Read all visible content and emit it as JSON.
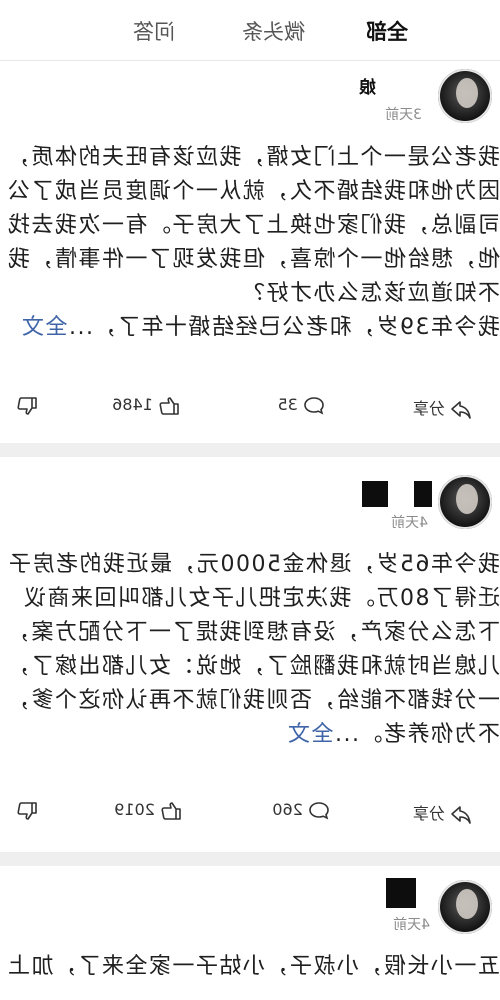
{
  "tabs": [
    {
      "label": "全部",
      "active": true
    },
    {
      "label": "微头条",
      "active": false
    },
    {
      "label": "问答",
      "active": false
    }
  ],
  "posts": [
    {
      "name_fragment": "娘",
      "time": "3天前",
      "lines": [
        "我老公是一个上门女婿，我应该有旺夫的体质，",
        "因为他和我结婚不久，就从一个调度员当成了公",
        "司副总，我们家也换上了大房子。有一次我去找",
        "他，想给他一个惊喜，但我发现了一件事情，我",
        "不知道应该怎么办才好？"
      ],
      "preview": "我今年39岁，和老公已经结婚十年了，...",
      "full_label": "全文",
      "share_label": "分享",
      "comments": "35",
      "likes": "1486"
    },
    {
      "name_fragment": "",
      "time": "4天前",
      "lines": [
        "我今年65岁，退休金5000元，最近我的老房子",
        "迁得了80万。我决定把儿子女儿都叫回来商议",
        "下怎么分家产，没有想到我提了一下分配方案，",
        "儿媳当时就和我翻脸了，她说：女儿都出嫁了，",
        "一分钱都不能给，否则我们就不再认你这个爹，"
      ],
      "preview": "不为你养老。...",
      "full_label": "全文",
      "share_label": "分享",
      "comments": "260",
      "likes": "2019"
    },
    {
      "name_fragment": "",
      "time": "4天前",
      "lines": [
        "五一小长假，小叔子，小姑子一家全来了，加上"
      ]
    }
  ]
}
